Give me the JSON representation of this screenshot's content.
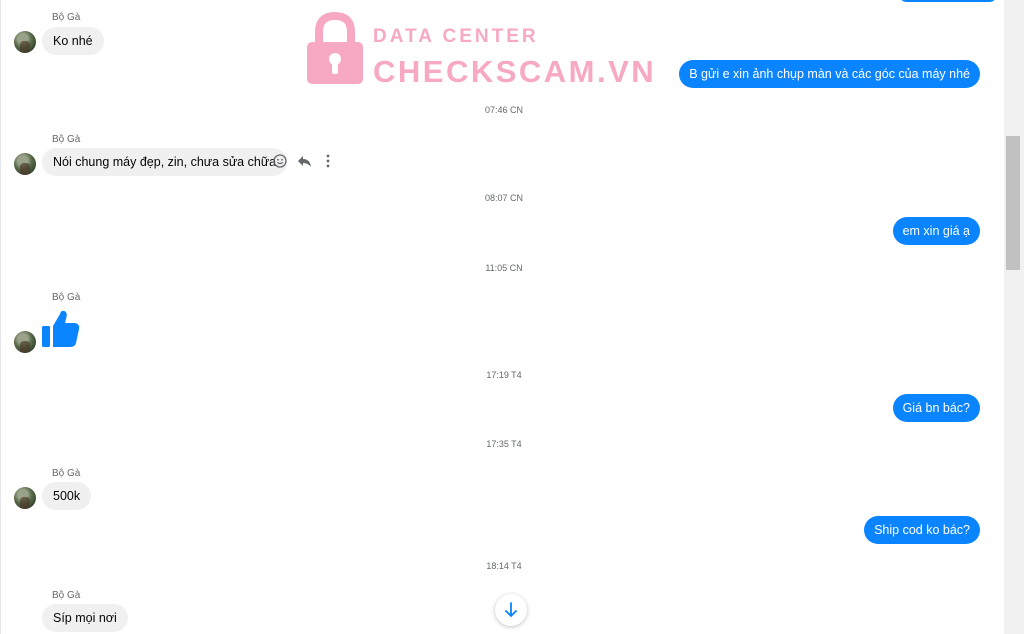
{
  "sender_name": "Bộ Gà",
  "messages": {
    "m1": "Ko nhé",
    "m2": "B gửi e xin ảnh chụp màn và các góc của máy nhé",
    "m3": "Nói chung máy đẹp, zin, chưa sửa chữa",
    "m4": "em xin giá ạ",
    "m5": "Giá bn bác?",
    "m6": "500k",
    "m7": "Ship cod ko bác?",
    "m8": "Síp mọi nơi"
  },
  "timestamps": {
    "t1": "07:46 CN",
    "t2": "08:07 CN",
    "t3": "11:05 CN",
    "t4": "17:19 T4",
    "t5": "17:35 T4",
    "t6": "18:14 T4"
  },
  "watermark": {
    "line1": "DATA CENTER",
    "line2": "CHECKSCAM.VN"
  },
  "icons": {
    "react": "smiley-icon",
    "reply": "reply-icon",
    "more": "more-vertical-icon",
    "like": "thumbs-up-icon",
    "scroll": "arrow-down-icon"
  },
  "colors": {
    "outgoing_bubble": "#0a84ff",
    "incoming_bubble": "#f0f0f0",
    "watermark": "#f7a9c4",
    "like_icon": "#0a84ff"
  }
}
